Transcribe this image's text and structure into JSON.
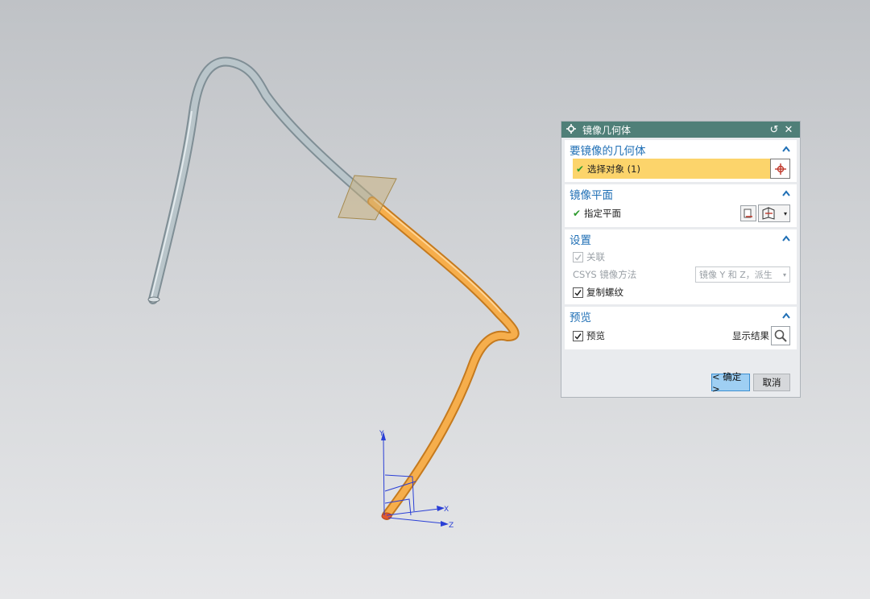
{
  "dialog": {
    "title": "镜像几何体",
    "groups": {
      "geometry": {
        "title": "要镜像的几何体",
        "select_object": "选择对象 (1)"
      },
      "plane": {
        "title": "镜像平面",
        "specify_plane": "指定平面"
      },
      "settings": {
        "title": "设置",
        "associative": "关联",
        "csys_label": "CSYS 镜像方法",
        "csys_value": "镜像 Y 和 Z，派生",
        "copy_threads": "复制螺纹"
      },
      "preview": {
        "title": "预览",
        "preview_label": "预览",
        "show_result": "显示结果"
      }
    },
    "ok_label": "< 确定 >",
    "cancel_label": "取消"
  },
  "viewport": {
    "axis_x": "X",
    "axis_y": "Y",
    "axis_z": "Z",
    "colors": {
      "original_pipe": "#a9b6bc",
      "mirrored_pipe": "#f3a947",
      "mirror_plane": "#c9b07a",
      "triad": "#2a3fd6"
    }
  }
}
